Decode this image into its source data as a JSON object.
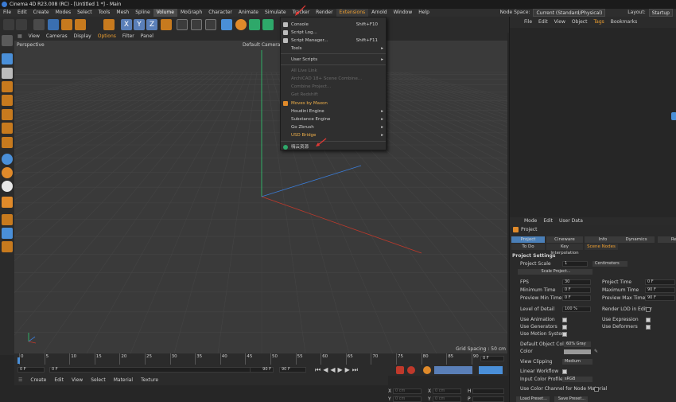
{
  "window": {
    "title": "Cinema 4D R23.008 (RC) - [Untitled 1 *] - Main"
  },
  "menubar": {
    "items": [
      "File",
      "Edit",
      "Create",
      "Modes",
      "Select",
      "Tools",
      "Mesh",
      "Spline",
      "Volume",
      "MoGraph",
      "Character",
      "Animate",
      "Simulate",
      "Tracker",
      "Render",
      "Extensions",
      "Arnold",
      "Window",
      "Help"
    ],
    "node_space_label": "Node Space:",
    "node_space_value": "Current (Standard/Physical)",
    "layout_label": "Layout:",
    "layout_value": "Startup"
  },
  "viewport_menu": [
    "View",
    "Cameras",
    "Display",
    "Options",
    "Filter",
    "Panel"
  ],
  "viewport": {
    "name": "Perspective",
    "camera": "Default Camera",
    "grid_spacing": "Grid Spacing : 50 cm"
  },
  "extensions_menu": {
    "items": [
      {
        "label": "Console",
        "shortcut": "Shift+F10",
        "icon": "console-icon",
        "disabled": false,
        "submenu": false
      },
      {
        "label": "Script Log...",
        "shortcut": "",
        "icon": "script-log-icon",
        "disabled": false,
        "submenu": false
      },
      {
        "label": "Script Manager...",
        "shortcut": "Shift+F11",
        "icon": "script-manager-icon",
        "disabled": false,
        "submenu": false
      },
      {
        "label": "Tools",
        "shortcut": "",
        "icon": "",
        "disabled": false,
        "submenu": true
      },
      {
        "label": "User Scripts",
        "shortcut": "",
        "icon": "",
        "disabled": false,
        "submenu": true
      },
      {
        "label": "All Live Link",
        "shortcut": "",
        "icon": "",
        "disabled": true,
        "submenu": false
      },
      {
        "label": "ArchiCAD 18+ Scene Combine...",
        "shortcut": "",
        "icon": "",
        "disabled": true,
        "submenu": false
      },
      {
        "label": "Combine Project...",
        "shortcut": "",
        "icon": "",
        "disabled": true,
        "submenu": false
      },
      {
        "label": "Get Redshift",
        "shortcut": "",
        "icon": "",
        "disabled": true,
        "submenu": false
      },
      {
        "label": "Moves by Maxon",
        "shortcut": "",
        "icon": "moves-icon",
        "disabled": false,
        "submenu": false
      },
      {
        "label": "Houdini Engine",
        "shortcut": "",
        "icon": "",
        "disabled": false,
        "submenu": true
      },
      {
        "label": "Substance Engine",
        "shortcut": "",
        "icon": "",
        "disabled": false,
        "submenu": true
      },
      {
        "label": "Go Zbrush",
        "shortcut": "",
        "icon": "",
        "disabled": false,
        "submenu": true
      },
      {
        "label": "USD Bridge",
        "shortcut": "",
        "icon": "",
        "disabled": false,
        "submenu": true
      },
      {
        "label": "嗨云资源",
        "shortcut": "",
        "icon": "plugin-icon",
        "disabled": false,
        "submenu": false
      }
    ]
  },
  "timeline": {
    "ticks": [
      "0",
      "5",
      "10",
      "15",
      "20",
      "25",
      "30",
      "35",
      "40",
      "45",
      "50",
      "55",
      "60",
      "65",
      "70",
      "75",
      "80",
      "85",
      "90"
    ],
    "end_frame": "0 F",
    "current_frame": "0 F",
    "start_frame": "0 F",
    "min_end": "90 F",
    "max_end": "90 F"
  },
  "material_menu": [
    "Create",
    "Edit",
    "View",
    "Select",
    "Material",
    "Texture"
  ],
  "coordinates": {
    "labels": [
      "X",
      "Y",
      "Z"
    ],
    "value_placeholder": "0 cm"
  },
  "object_manager": {
    "menu": [
      "File",
      "Edit",
      "View",
      "Object",
      "Tags",
      "Bookmarks"
    ]
  },
  "attributes": {
    "menu": [
      "Mode",
      "Edit",
      "User Data"
    ],
    "section": "Project",
    "tabs_row1": [
      "Project Settings",
      "Cineware",
      "Info",
      "Dynamics",
      "Refe"
    ],
    "tabs_row2": [
      "To Do",
      "Key Interpolation",
      "Scene Nodes"
    ],
    "heading": "Project Settings",
    "project_scale_label": "Project Scale",
    "project_scale_value": "1",
    "project_scale_unit": "Centimeters",
    "scale_button": "Scale Project...",
    "fps_label": "FPS",
    "fps_value": "30",
    "project_time_label": "Project Time",
    "project_time_value": "0 F",
    "min_time_label": "Minimum Time",
    "min_time_value": "0 F",
    "max_time_label": "Maximum Time",
    "max_time_value": "90 F",
    "prev_min_label": "Preview Min Time",
    "prev_min_value": "0 F",
    "prev_max_label": "Preview Max Time",
    "prev_max_value": "90 F",
    "lod_label": "Level of Detail",
    "lod_value": "100 %",
    "render_lod_label": "Render LOD in Editor",
    "use_animation": "Use Animation",
    "use_expression": "Use Expression",
    "use_generators": "Use Generators",
    "use_deformers": "Use Deformers",
    "use_motion": "Use Motion System",
    "default_color_label": "Default Object Color",
    "default_color_value": "60% Gray",
    "color_label": "Color",
    "view_clipping_label": "View Clipping",
    "view_clipping_value": "Medium",
    "linear_workflow": "Linear Workflow",
    "input_color_label": "Input Color Profile",
    "input_color_value": "sRGB",
    "use_color_channel": "Use Color Channel for Node Material",
    "load_preset": "Load Preset...",
    "save_preset": "Save Preset..."
  },
  "colors": {
    "accent": "#4a8fd8",
    "menu_highlight": "#f0a030",
    "axis_x": "#c0392b",
    "axis_y": "#2ecc71",
    "axis_z": "#3a7bd5"
  }
}
